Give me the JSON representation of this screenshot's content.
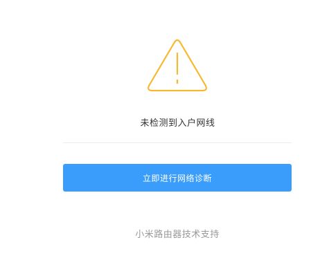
{
  "status": {
    "icon": "warning-triangle-icon",
    "message": "未检测到入户网线",
    "icon_color": "#f5b82e"
  },
  "actions": {
    "diagnose_label": "立即进行网络诊断",
    "button_color": "#3a9dfb"
  },
  "footer": {
    "support_label": "小米路由器技术支持"
  }
}
